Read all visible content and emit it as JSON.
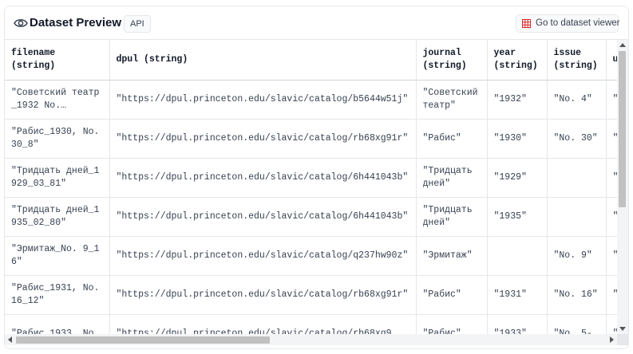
{
  "header": {
    "title": "Dataset Preview",
    "api_label": "API",
    "viewer_button_label": "Go to dataset viewer"
  },
  "columns": [
    {
      "name": "filename",
      "type": "(string)"
    },
    {
      "name": "dpul (string)",
      "type": ""
    },
    {
      "name": "journal",
      "type": "(string)"
    },
    {
      "name": "year",
      "type": "(string)"
    },
    {
      "name": "issue",
      "type": "(string)"
    },
    {
      "name": "u",
      "type": ""
    }
  ],
  "rows": [
    {
      "filename": "\"Советский театр_1932 No.…",
      "dpul": "\"https://dpul.princeton.edu/slavic/catalog/b5644w51j\"",
      "journal": "\"Советский театр\"",
      "year": "\"1932\"",
      "issue": "\"No. 4\"",
      "u": "\"c"
    },
    {
      "filename": "\"Рабис_1930, No. 30_8\"",
      "dpul": "\"https://dpul.princeton.edu/slavic/catalog/rb68xg91r\"",
      "journal": "\"Рабис\"",
      "year": "\"1930\"",
      "issue": "\"No. 30\"",
      "u": "\"c"
    },
    {
      "filename": "\"Тридцать дней_1929_03_81\"",
      "dpul": "\"https://dpul.princeton.edu/slavic/catalog/6h441043b\"",
      "journal": "\"Тридцать дней\"",
      "year": "\"1929\"",
      "issue": "",
      "u": "\""
    },
    {
      "filename": "\"Тридцать дней_1935_02_80\"",
      "dpul": "\"https://dpul.princeton.edu/slavic/catalog/6h441043b\"",
      "journal": "\"Тридцать дней\"",
      "year": "\"1935\"",
      "issue": "",
      "u": "\""
    },
    {
      "filename": "\"Эрмитаж_No. 9_16\"",
      "dpul": "\"https://dpul.princeton.edu/slavic/catalog/q237hw90z\"",
      "journal": "\"Эрмитаж\"",
      "year": "",
      "issue": "\"No. 9\"",
      "u": "\"c"
    },
    {
      "filename": "\"Рабис_1931, No. 16_12\"",
      "dpul": "\"https://dpul.princeton.edu/slavic/catalog/rb68xg91r\"",
      "journal": "\"Рабис\"",
      "year": "\"1931\"",
      "issue": "\"No. 16\"",
      "u": "\"c"
    },
    {
      "filename": "\"Рабис_1933, No.",
      "dpul": "\"https://dpul.princeton.edu/slavic/catalog/rb68xg9",
      "journal": "\"Рабис\"",
      "year": "\"1933\"",
      "issue": "\"No. 5-",
      "u": "\""
    }
  ],
  "colors": {
    "border": "#e5e7eb",
    "grid_icon": "#dc2626",
    "scroll_thumb": "#c1c1c1"
  },
  "icons": {
    "title_icon": "eye-icon",
    "viewer_icon": "grid-icon"
  },
  "scroll": {
    "vertical_position": 0.0,
    "horizontal_position": 0.0
  }
}
